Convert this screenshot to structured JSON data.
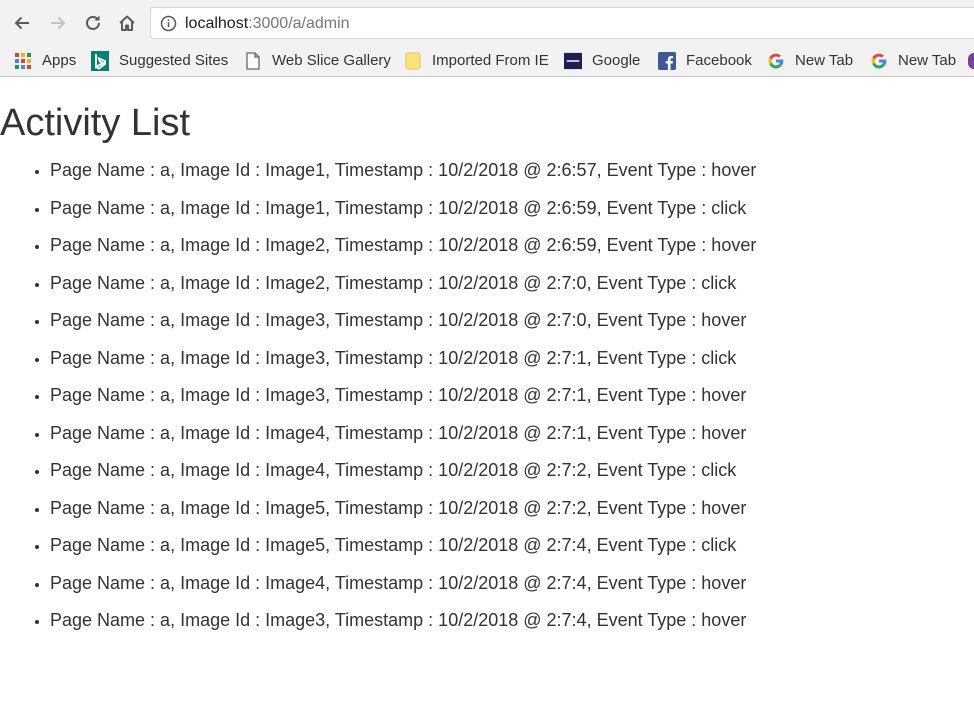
{
  "browser": {
    "url_host": "localhost",
    "url_path": ":3000/a/admin",
    "bookmarks": [
      {
        "label": "Apps",
        "icon": "apps-grid-icon"
      },
      {
        "label": "Suggested Sites",
        "icon": "bing-icon"
      },
      {
        "label": "Web Slice Gallery",
        "icon": "page-icon"
      },
      {
        "label": "Imported From IE",
        "icon": "folder-icon"
      },
      {
        "label": "Google",
        "icon": "fma-icon"
      },
      {
        "label": "Facebook",
        "icon": "facebook-icon"
      },
      {
        "label": "New Tab",
        "icon": "google-g-icon"
      },
      {
        "label": "New Tab",
        "icon": "google-g-icon"
      }
    ]
  },
  "page": {
    "title": "Activity List",
    "activities": [
      "Page Name : a, Image Id : Image1, Timestamp : 10/2/2018 @ 2:6:57, Event Type : hover",
      "Page Name : a, Image Id : Image1, Timestamp : 10/2/2018 @ 2:6:59, Event Type : click",
      "Page Name : a, Image Id : Image2, Timestamp : 10/2/2018 @ 2:6:59, Event Type : hover",
      "Page Name : a, Image Id : Image2, Timestamp : 10/2/2018 @ 2:7:0, Event Type : click",
      "Page Name : a, Image Id : Image3, Timestamp : 10/2/2018 @ 2:7:0, Event Type : hover",
      "Page Name : a, Image Id : Image3, Timestamp : 10/2/2018 @ 2:7:1, Event Type : click",
      "Page Name : a, Image Id : Image3, Timestamp : 10/2/2018 @ 2:7:1, Event Type : hover",
      "Page Name : a, Image Id : Image4, Timestamp : 10/2/2018 @ 2:7:1, Event Type : hover",
      "Page Name : a, Image Id : Image4, Timestamp : 10/2/2018 @ 2:7:2, Event Type : click",
      "Page Name : a, Image Id : Image5, Timestamp : 10/2/2018 @ 2:7:2, Event Type : hover",
      "Page Name : a, Image Id : Image5, Timestamp : 10/2/2018 @ 2:7:4, Event Type : click",
      "Page Name : a, Image Id : Image4, Timestamp : 10/2/2018 @ 2:7:4, Event Type : hover",
      "Page Name : a, Image Id : Image3, Timestamp : 10/2/2018 @ 2:7:4, Event Type : hover"
    ]
  },
  "colors": {
    "chrome_bg": "#f2f2f2",
    "text": "#333333",
    "facebook": "#3b5998",
    "bing": "#008373"
  }
}
